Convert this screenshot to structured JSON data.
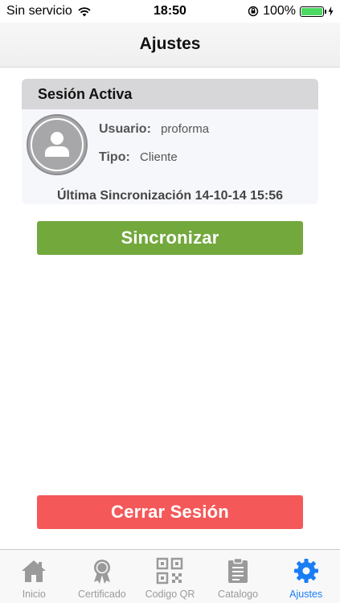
{
  "status_bar": {
    "carrier": "Sin servicio",
    "time": "18:50",
    "battery_percent": "100%",
    "battery_level": 1.0
  },
  "nav": {
    "title": "Ajustes"
  },
  "session": {
    "header": "Sesión Activa",
    "user_label": "Usuario:",
    "user_value": "proforma",
    "type_label": "Tipo:",
    "type_value": "Cliente",
    "last_sync": "Última Sincronización 14-10-14 15:56"
  },
  "buttons": {
    "sync_label": "Sincronizar",
    "logout_label": "Cerrar Sesión"
  },
  "tabs": [
    {
      "label": "Inicio",
      "icon": "home-icon",
      "active": false
    },
    {
      "label": "Certificado",
      "icon": "certificate-icon",
      "active": false
    },
    {
      "label": "Codigo QR",
      "icon": "qr-code-icon",
      "active": false
    },
    {
      "label": "Catalogo",
      "icon": "clipboard-icon",
      "active": false
    },
    {
      "label": "Ajustes",
      "icon": "gear-icon",
      "active": true
    }
  ],
  "colors": {
    "sync_button": "#72a83c",
    "logout_button": "#f55858",
    "tab_active": "#1a7df5",
    "tab_inactive": "#9a9a9a"
  }
}
